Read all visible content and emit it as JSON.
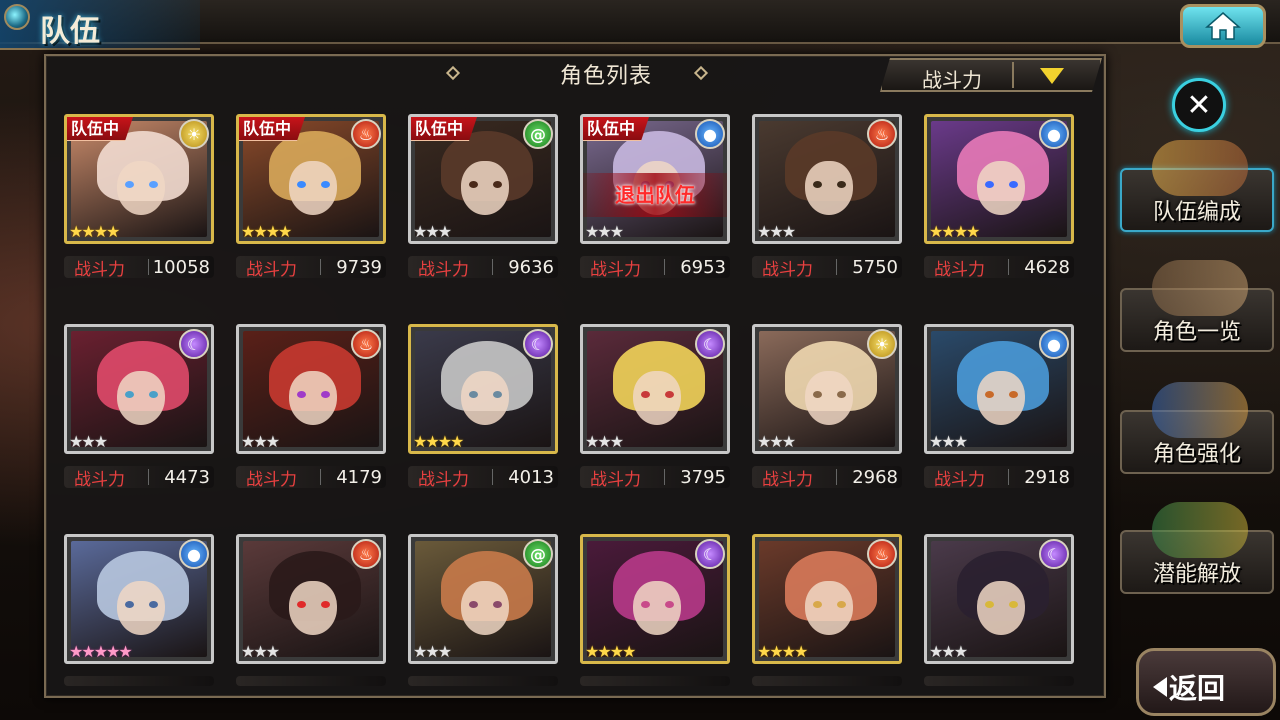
{
  "header": {
    "title": "队伍"
  },
  "panel": {
    "title": "角色列表",
    "sort_label": "战斗力"
  },
  "power_label": "战斗力",
  "leave_label": "退出队伍",
  "characters": [
    {
      "in_team": true,
      "team_tag": "队伍中",
      "element": "light",
      "stars": 4,
      "star_style": "golden",
      "frame": "gold",
      "power": "10058",
      "hair": "#f2dcd0",
      "bg": "#c88a6a",
      "eye": "#5aa0ff"
    },
    {
      "in_team": true,
      "team_tag": "队伍中",
      "element": "fire",
      "stars": 4,
      "star_style": "golden",
      "frame": "gold",
      "power": "9739",
      "hair": "#d8a85a",
      "bg": "#8a4a2a",
      "eye": "#3a8aff"
    },
    {
      "in_team": true,
      "team_tag": "队伍中",
      "element": "wind",
      "stars": 3,
      "star_style": "silver",
      "frame": "sv",
      "power": "9636",
      "hair": "#5a3a2a",
      "bg": "#3a2a20",
      "eye": "#4a2a1a"
    },
    {
      "in_team": true,
      "team_tag": "队伍中",
      "element": "water",
      "stars": 3,
      "star_style": "silver",
      "frame": "sv",
      "power": "6953",
      "hair": "#c8b8e0",
      "bg": "#7a6a90",
      "eye": "#9a6ac8",
      "leave": true
    },
    {
      "in_team": false,
      "element": "fire",
      "stars": 3,
      "star_style": "silver",
      "frame": "sv",
      "power": "5750",
      "hair": "#5a3a28",
      "bg": "#4a3a30",
      "eye": "#3a2a1a"
    },
    {
      "in_team": false,
      "element": "water",
      "stars": 4,
      "star_style": "golden",
      "frame": "gold",
      "power": "4628",
      "hair": "#e87ab8",
      "bg": "#6a3a8a",
      "eye": "#3a6aff"
    },
    {
      "in_team": false,
      "element": "dark",
      "stars": 3,
      "star_style": "silver",
      "frame": "sv",
      "power": "4473",
      "hair": "#e04a6a",
      "bg": "#6a2030",
      "eye": "#4aa0c8"
    },
    {
      "in_team": false,
      "element": "fire",
      "stars": 3,
      "star_style": "silver",
      "frame": "sv",
      "power": "4179",
      "hair": "#c83a30",
      "bg": "#5a2018",
      "eye": "#a03ac8"
    },
    {
      "in_team": false,
      "element": "dark",
      "stars": 4,
      "star_style": "golden",
      "frame": "gold",
      "power": "4013",
      "hair": "#c8c8c8",
      "bg": "#3a3a4a",
      "eye": "#6a8aa0"
    },
    {
      "in_team": false,
      "element": "dark",
      "stars": 3,
      "star_style": "silver",
      "frame": "sv",
      "power": "3795",
      "hair": "#f2d45a",
      "bg": "#5a2a3a",
      "eye": "#c83a3a"
    },
    {
      "in_team": false,
      "element": "light",
      "stars": 3,
      "star_style": "silver",
      "frame": "sv",
      "power": "2968",
      "hair": "#f0d8b0",
      "bg": "#8a6a5a",
      "eye": "#8a6a4a"
    },
    {
      "in_team": false,
      "element": "water",
      "stars": 3,
      "star_style": "silver",
      "frame": "sv",
      "power": "2918",
      "hair": "#4a9ad8",
      "bg": "#2a4a6a",
      "eye": "#c86a2a"
    },
    {
      "in_team": false,
      "element": "water",
      "stars": 5,
      "star_style": "rainbow",
      "frame": "sv",
      "power": "",
      "hair": "#b8c8e0",
      "bg": "#5a6a9a",
      "eye": "#4a6aa0"
    },
    {
      "in_team": false,
      "element": "fire",
      "stars": 3,
      "star_style": "silver",
      "frame": "sv",
      "power": "",
      "hair": "#2a1a1a",
      "bg": "#5a3a3a",
      "eye": "#e02a2a"
    },
    {
      "in_team": false,
      "element": "wind",
      "stars": 3,
      "star_style": "silver",
      "frame": "sv",
      "power": "",
      "hair": "#c87a4a",
      "bg": "#6a5a3a",
      "eye": "#8a4a6a"
    },
    {
      "in_team": false,
      "element": "dark",
      "stars": 4,
      "star_style": "golden",
      "frame": "gold",
      "power": "",
      "hair": "#b83a8a",
      "bg": "#4a1a3a",
      "eye": "#c84a8a"
    },
    {
      "in_team": false,
      "element": "fire",
      "stars": 4,
      "star_style": "golden",
      "frame": "gold",
      "power": "",
      "hair": "#d87a5a",
      "bg": "#6a3a2a",
      "eye": "#d8a84a"
    },
    {
      "in_team": false,
      "element": "dark",
      "stars": 3,
      "star_style": "silver",
      "frame": "sv",
      "power": "",
      "hair": "#2a2030",
      "bg": "#4a3a4a",
      "eye": "#d8b83a"
    }
  ],
  "side_menu": {
    "close_icon": "close-icon",
    "items": [
      {
        "label": "队伍编成",
        "active": true
      },
      {
        "label": "角色一览",
        "active": false
      },
      {
        "label": "角色强化",
        "active": false
      },
      {
        "label": "潜能解放",
        "active": false
      }
    ]
  },
  "back_button": {
    "label": "返回"
  },
  "colors": {
    "accent": "#3ad0e0",
    "power_label": "#e84040",
    "team_tag": "#c8141a",
    "sort_arrow": "#f2d22e"
  }
}
